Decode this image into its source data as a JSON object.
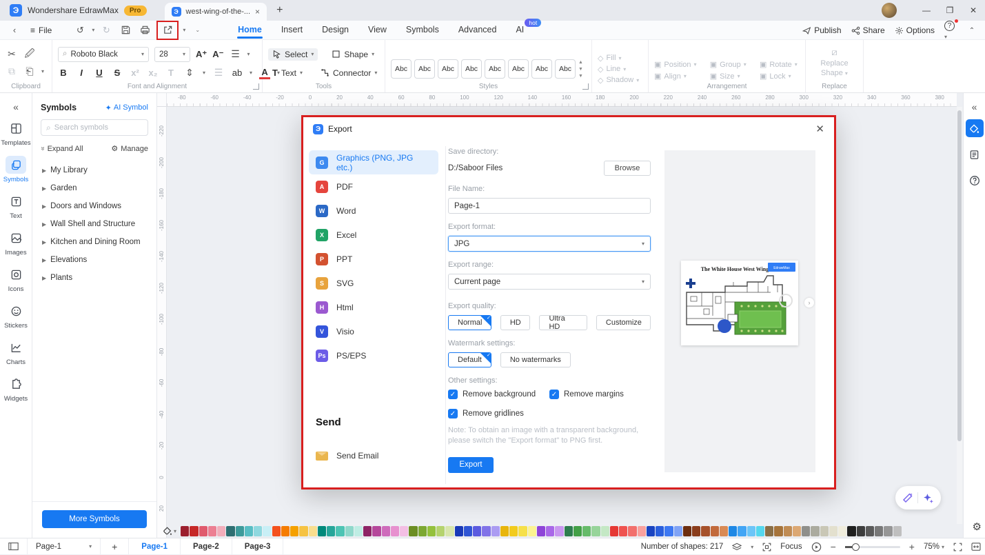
{
  "titlebar": {
    "app_name": "Wondershare EdrawMax",
    "pro_badge": "Pro",
    "doc_tab": "west-wing-of-the-...",
    "close_tab": "×",
    "new_tab": "+",
    "logo_glyph": "Э"
  },
  "menubar": {
    "file_label": "File",
    "tabs": [
      {
        "label": "Home",
        "active": true
      },
      {
        "label": "Insert"
      },
      {
        "label": "Design"
      },
      {
        "label": "View"
      },
      {
        "label": "Symbols"
      },
      {
        "label": "Advanced"
      },
      {
        "label": "AI",
        "badge": "hot"
      }
    ],
    "publish": "Publish",
    "share": "Share",
    "options": "Options"
  },
  "ribbon": {
    "font_name": "Roboto Black",
    "font_size": "28",
    "group_labels": {
      "clipboard": "Clipboard",
      "font": "Font and Alignment",
      "tools": "Tools",
      "styles": "Styles",
      "arrangement": "Arrangement",
      "replace": "Replace"
    },
    "tools": {
      "select": "Select",
      "shape": "Shape",
      "text": "Text",
      "connector": "Connector"
    },
    "styles": [
      "Abc",
      "Abc",
      "Abc",
      "Abc",
      "Abc",
      "Abc",
      "Abc",
      "Abc"
    ],
    "effects": [
      {
        "label": "Fill"
      },
      {
        "label": "Line"
      },
      {
        "label": "Shadow"
      }
    ],
    "arrangement": [
      {
        "label": "Position"
      },
      {
        "label": "Group"
      },
      {
        "label": "Rotate"
      },
      {
        "label": "Align"
      },
      {
        "label": "Size"
      },
      {
        "label": "Lock"
      }
    ],
    "replace_shape_1": "Replace",
    "replace_shape_2": "Shape"
  },
  "left_rail": {
    "items": [
      {
        "label": "Templates"
      },
      {
        "label": "Symbols",
        "active": true
      },
      {
        "label": "Text"
      },
      {
        "label": "Images"
      },
      {
        "label": "Icons"
      },
      {
        "label": "Stickers"
      },
      {
        "label": "Charts"
      },
      {
        "label": "Widgets"
      }
    ]
  },
  "symbols_panel": {
    "title": "Symbols",
    "ai_symbol": "AI Symbol",
    "search_placeholder": "Search symbols",
    "expand_all": "Expand All",
    "manage": "Manage",
    "libraries": [
      {
        "label": "My Library"
      },
      {
        "label": "Garden"
      },
      {
        "label": "Doors and Windows"
      },
      {
        "label": "Wall Shell and Structure"
      },
      {
        "label": "Kitchen and Dining Room"
      },
      {
        "label": "Elevations"
      },
      {
        "label": "Plants"
      }
    ],
    "more_symbols": "More Symbols"
  },
  "rulers": {
    "horizontal": [
      "-80",
      "-60",
      "-40",
      "-20",
      "0",
      "20",
      "40",
      "60",
      "80",
      "100",
      "120",
      "140",
      "160",
      "180",
      "200",
      "220",
      "240",
      "260",
      "280",
      "300",
      "320",
      "340",
      "360",
      "380"
    ],
    "vertical": [
      "-220",
      "-200",
      "-180",
      "-160",
      "-140",
      "-120",
      "-100",
      "-80",
      "-60",
      "-40",
      "-20",
      "0",
      "20"
    ]
  },
  "export_dialog": {
    "title": "Export",
    "formats": [
      {
        "label": "Graphics (PNG, JPG etc.)",
        "letter": "G",
        "color": "#3d8af0",
        "active": true
      },
      {
        "label": "PDF",
        "letter": "A",
        "color": "#e5453d"
      },
      {
        "label": "Word",
        "letter": "W",
        "color": "#2b69c6"
      },
      {
        "label": "Excel",
        "letter": "X",
        "color": "#21a366"
      },
      {
        "label": "PPT",
        "letter": "P",
        "color": "#d35230"
      },
      {
        "label": "SVG",
        "letter": "S",
        "color": "#e8a33d"
      },
      {
        "label": "Html",
        "letter": "H",
        "color": "#9b59d0"
      },
      {
        "label": "Visio",
        "letter": "V",
        "color": "#3455db"
      },
      {
        "label": "PS/EPS",
        "letter": "Ps",
        "color": "#6c5ce7"
      }
    ],
    "send_heading": "Send",
    "send_email": "Send Email",
    "save_directory_label": "Save directory:",
    "save_directory_value": "D:/Saboor Files",
    "browse": "Browse",
    "file_name_label": "File Name:",
    "file_name_value": "Page-1",
    "export_format_label": "Export format:",
    "export_format_value": "JPG",
    "export_range_label": "Export range:",
    "export_range_value": "Current page",
    "export_quality_label": "Export quality:",
    "quality_options": [
      {
        "label": "Normal",
        "active": true
      },
      {
        "label": "HD"
      },
      {
        "label": "Ultra HD"
      },
      {
        "label": "Customize"
      }
    ],
    "watermark_label": "Watermark settings:",
    "watermark_options": [
      {
        "label": "Default",
        "active": true
      },
      {
        "label": "No watermarks"
      }
    ],
    "other_settings_label": "Other settings:",
    "checkboxes": [
      {
        "label": "Remove background",
        "checked": true
      },
      {
        "label": "Remove margins",
        "checked": true
      },
      {
        "label": "Remove gridlines",
        "checked": true
      }
    ],
    "note": "Note: To obtain an image with a transparent background, please switch the \"Export format\" to PNG first.",
    "export_button": "Export",
    "preview": {
      "title": "The White House West Wing",
      "badge": "EdrawMax"
    }
  },
  "palette": {
    "colors": [
      "#9C1F2E",
      "#C62828",
      "#E05A6D",
      "#EC7F92",
      "#F2AEBB",
      "#2E6F72",
      "#3D9B9B",
      "#58BEC4",
      "#8FD8DF",
      "#C9EFF6",
      "#F4511E",
      "#F57C00",
      "#F5A100",
      "#F6C343",
      "#F8DE8F",
      "#00897B",
      "#26A69A",
      "#4DC4B4",
      "#8FD8CB",
      "#BFEDE4",
      "#8E2466",
      "#B5479B",
      "#CE6BBB",
      "#E791CF",
      "#F3BFE4",
      "#6B8E23",
      "#7CA832",
      "#94C13D",
      "#B5D36E",
      "#D8E6AC",
      "#1A3AB8",
      "#2F55D4",
      "#5B5BE0",
      "#8173E8",
      "#AB9CF2",
      "#E8B50C",
      "#F2CB1D",
      "#F6E049",
      "#FBF392",
      "#8E44D8",
      "#A968E8",
      "#C997F0",
      "#2E7D4F",
      "#43A047",
      "#66BB6A",
      "#97D49A",
      "#C4E8C5",
      "#E53935",
      "#EF5350",
      "#F2706D",
      "#F9A19E",
      "#1944C1",
      "#2A5FDD",
      "#3D78F2",
      "#7FA3F6",
      "#6D2E0F",
      "#8A3D1C",
      "#A6512B",
      "#C26A3C",
      "#D98A55",
      "#1E88E5",
      "#42A5F5",
      "#6CC5F8",
      "#55D7EE",
      "#8A6F47",
      "#A6743B",
      "#C08C54",
      "#DCA873",
      "#8F8F8B",
      "#ABAB9F",
      "#C9C7B6",
      "#E3E0CE",
      "#F0EDDD",
      "#1F1F1F",
      "#3D3D3D",
      "#5A5A5A",
      "#787878",
      "#969696",
      "#BFBFBF"
    ]
  },
  "statusbar": {
    "page_selector": "Page-1",
    "tabs": [
      {
        "label": "Page-1",
        "active": true
      },
      {
        "label": "Page-2"
      },
      {
        "label": "Page-3"
      }
    ],
    "shapes_count": "Number of shapes: 217",
    "focus_label": "Focus",
    "zoom_value": "75%"
  }
}
